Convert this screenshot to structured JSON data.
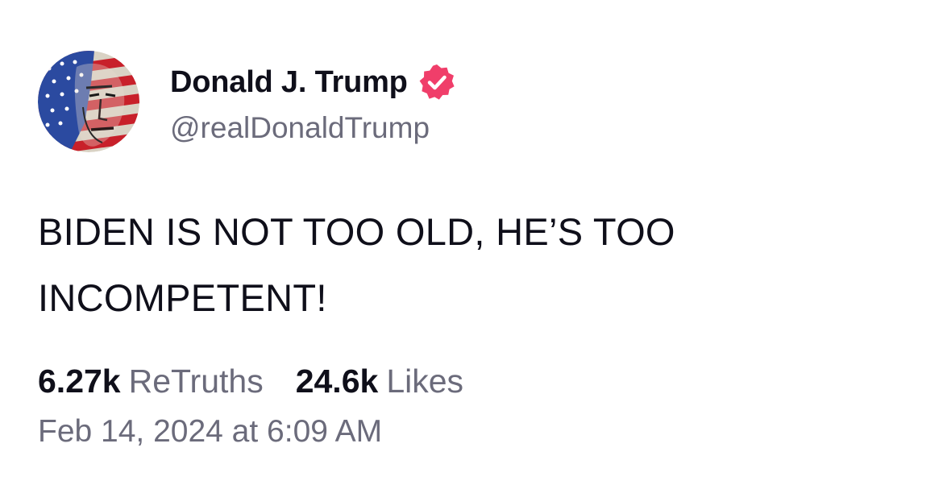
{
  "author": {
    "display_name": "Donald J. Trump",
    "handle": "@realDonaldTrump",
    "verified": true,
    "verified_color": "#f03e6a",
    "avatar_icon": "flag-portrait-avatar"
  },
  "post": {
    "text_line1": "BIDEN IS NOT TOO OLD, HE’S TOO",
    "text_line2": "INCOMPETENT!"
  },
  "stats": {
    "retruths_count": "6.27k",
    "retruths_label": "ReTruths",
    "likes_count": "24.6k",
    "likes_label": "Likes"
  },
  "timestamp": "Feb 14, 2024 at 6:09 AM",
  "colors": {
    "text_primary": "#0f0f1a",
    "text_secondary": "#6b6b7b",
    "background": "#ffffff"
  }
}
